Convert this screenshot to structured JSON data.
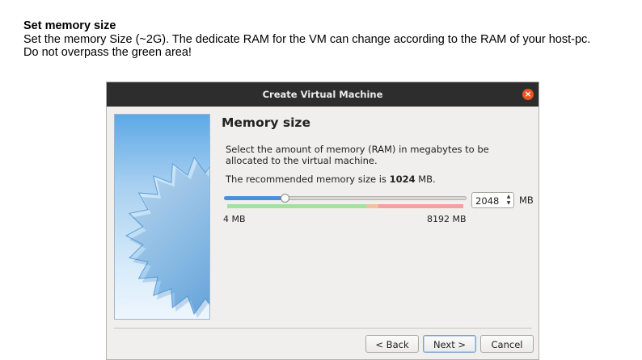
{
  "doc": {
    "heading": "Set memory size",
    "line1": "Set the memory Size (~2G). The dedicate RAM for the VM can change according to the RAM of your host-pc.",
    "line2": "Do not overpass the green area!"
  },
  "dialog": {
    "title": "Create Virtual Machine",
    "page_title": "Memory size",
    "description": "Select the amount of memory (RAM) in megabytes to be allocated to the virtual machine.",
    "recommend_prefix": "The recommended memory size is ",
    "recommend_value": "1024",
    "recommend_suffix": " MB.",
    "memory": {
      "value": "2048",
      "unit": "MB",
      "min_label": "4 MB",
      "max_label": "8192 MB",
      "slider_fraction": 0.25
    },
    "buttons": {
      "back": "< Back",
      "next": "Next >",
      "cancel": "Cancel"
    }
  },
  "colors": {
    "titlebar": "#2d2d2d",
    "close": "#e95420",
    "slider_fill": "#4a90d9",
    "zone_green": "#9fe39f",
    "zone_red": "#f2a0a0"
  }
}
